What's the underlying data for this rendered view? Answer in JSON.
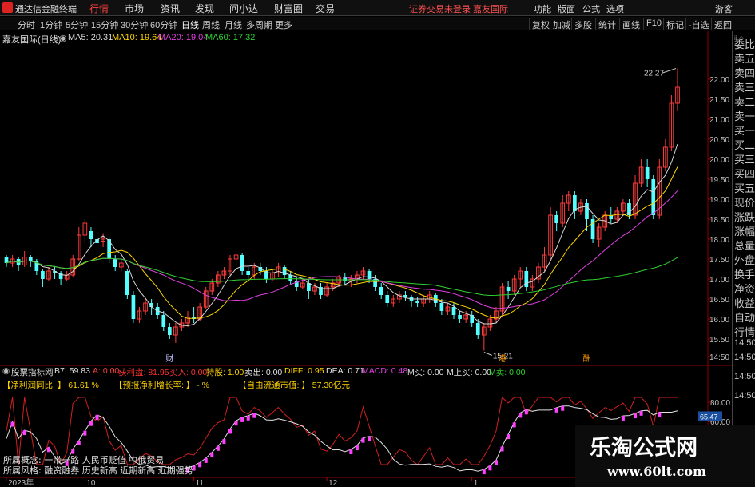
{
  "menubar": {
    "app_title": "通达信金融终端",
    "menus": [
      "行情",
      "市场",
      "资讯",
      "发现",
      "问小达",
      "财富圈",
      "交易"
    ],
    "active_menu": "行情",
    "broker_status": "证券交易未登录  嘉友国际",
    "right_menus": [
      "功能",
      "版面",
      "公式",
      "选项",
      "游客"
    ]
  },
  "periods": {
    "items": [
      "分时",
      "1分钟",
      "5分钟",
      "15分钟",
      "30分钟",
      "60分钟",
      "日线",
      "周线",
      "月线",
      "多周期",
      "更多"
    ],
    "active": "日线"
  },
  "toolbar": {
    "items": [
      "复权",
      "加减",
      "多股",
      "统计",
      "画线",
      "F10",
      "标记",
      "-自选",
      "返回"
    ]
  },
  "main_chart": {
    "stock_name": "嘉友国际(日线)",
    "ma": [
      {
        "label": "MA5: 20.31",
        "color": "#d8d8d8"
      },
      {
        "label": "MA10: 19.64",
        "color": "#ffd700"
      },
      {
        "label": "MA20: 19.04",
        "color": "#e040e0"
      },
      {
        "label": "MA60: 17.32",
        "color": "#30d030"
      }
    ],
    "high_label": "22.27",
    "low_label": "15.21",
    "markers": [
      "财",
      "港",
      "酬"
    ]
  },
  "chart_data": {
    "type": "candlestick",
    "period": "daily",
    "y_axis_ticks": [
      "22.00",
      "21.50",
      "21.00",
      "20.50",
      "20.00",
      "19.50",
      "19.00",
      "18.50",
      "18.00",
      "17.50",
      "17.00",
      "16.50",
      "16.00",
      "15.50",
      "14:50"
    ],
    "y_range": [
      15.3,
      22.5
    ],
    "x_labels": [
      "2023年",
      "10",
      "11",
      "12",
      "1"
    ],
    "candles": [
      [
        17.55,
        17.4,
        17.6,
        17.3
      ],
      [
        17.4,
        17.5,
        17.6,
        17.3
      ],
      [
        17.5,
        17.35,
        17.55,
        17.2
      ],
      [
        17.35,
        17.55,
        17.7,
        17.3
      ],
      [
        17.55,
        17.45,
        17.6,
        17.3
      ],
      [
        17.45,
        17.2,
        17.5,
        17.1
      ],
      [
        17.2,
        17.0,
        17.25,
        16.8
      ],
      [
        17.0,
        17.2,
        17.3,
        16.95
      ],
      [
        17.2,
        17.15,
        17.3,
        17.0
      ],
      [
        17.15,
        17.0,
        17.2,
        16.85
      ],
      [
        17.0,
        17.1,
        17.2,
        16.95
      ],
      [
        17.1,
        17.5,
        17.6,
        17.05
      ],
      [
        17.5,
        18.1,
        18.3,
        17.45
      ],
      [
        18.1,
        18.4,
        18.5,
        17.9
      ],
      [
        18.2,
        18.0,
        18.3,
        17.8
      ],
      [
        18.0,
        17.9,
        18.1,
        17.75
      ],
      [
        17.95,
        18.0,
        18.15,
        17.8
      ],
      [
        18.0,
        17.5,
        18.05,
        17.4
      ],
      [
        17.5,
        17.3,
        17.6,
        17.2
      ],
      [
        17.3,
        17.4,
        17.5,
        17.2
      ],
      [
        17.2,
        16.6,
        17.25,
        16.5
      ],
      [
        16.6,
        16.0,
        16.7,
        15.9
      ],
      [
        16.0,
        16.2,
        16.3,
        15.9
      ],
      [
        16.2,
        16.4,
        16.5,
        16.1
      ],
      [
        16.4,
        16.3,
        16.5,
        16.1
      ],
      [
        16.3,
        16.1,
        16.4,
        16.0
      ],
      [
        16.1,
        15.8,
        16.2,
        15.7
      ],
      [
        15.8,
        15.6,
        15.9,
        15.5
      ],
      [
        15.6,
        15.8,
        15.9,
        15.4
      ],
      [
        15.8,
        15.9,
        16.0,
        15.7
      ],
      [
        15.9,
        16.05,
        16.2,
        15.8
      ],
      [
        16.05,
        16.0,
        16.3,
        15.9
      ],
      [
        16.0,
        16.3,
        16.4,
        15.95
      ],
      [
        16.3,
        16.7,
        16.8,
        16.25
      ],
      [
        16.7,
        16.9,
        17.0,
        16.6
      ],
      [
        16.9,
        17.1,
        17.2,
        16.8
      ],
      [
        17.1,
        17.2,
        17.3,
        17.0
      ],
      [
        17.2,
        17.5,
        17.6,
        17.1
      ],
      [
        17.5,
        17.6,
        17.7,
        17.35
      ],
      [
        17.6,
        17.2,
        17.65,
        17.1
      ],
      [
        17.2,
        17.1,
        17.3,
        17.0
      ],
      [
        17.1,
        17.3,
        17.4,
        17.0
      ],
      [
        17.3,
        17.2,
        17.4,
        17.1
      ],
      [
        17.2,
        17.0,
        17.3,
        16.9
      ],
      [
        17.0,
        17.15,
        17.25,
        16.95
      ],
      [
        17.15,
        17.3,
        17.4,
        17.05
      ],
      [
        17.3,
        17.1,
        17.35,
        17.0
      ],
      [
        17.1,
        16.95,
        17.2,
        16.85
      ],
      [
        16.95,
        16.8,
        17.05,
        16.7
      ],
      [
        16.8,
        16.9,
        17.0,
        16.75
      ],
      [
        16.9,
        16.7,
        17.0,
        16.5
      ],
      [
        16.7,
        16.8,
        16.9,
        16.6
      ],
      [
        16.8,
        16.6,
        16.9,
        16.5
      ],
      [
        16.6,
        16.8,
        16.9,
        16.55
      ],
      [
        16.8,
        16.9,
        17.0,
        16.7
      ],
      [
        16.9,
        17.05,
        17.1,
        16.8
      ],
      [
        17.05,
        16.95,
        17.15,
        16.85
      ],
      [
        16.95,
        17.0,
        17.1,
        16.8
      ],
      [
        17.0,
        17.1,
        17.2,
        16.9
      ],
      [
        17.1,
        17.2,
        17.3,
        17.0
      ],
      [
        17.2,
        17.0,
        17.25,
        16.9
      ],
      [
        17.0,
        16.8,
        17.1,
        16.7
      ],
      [
        16.8,
        16.6,
        16.9,
        16.5
      ],
      [
        16.6,
        16.4,
        16.7,
        16.3
      ],
      [
        16.4,
        16.5,
        16.6,
        16.3
      ],
      [
        16.5,
        16.6,
        16.7,
        16.4
      ],
      [
        16.6,
        16.55,
        16.7,
        16.45
      ],
      [
        16.55,
        16.45,
        16.6,
        16.3
      ],
      [
        16.45,
        16.4,
        16.55,
        16.3
      ],
      [
        16.4,
        16.5,
        16.6,
        16.3
      ],
      [
        16.5,
        16.6,
        16.7,
        16.4
      ],
      [
        16.6,
        16.4,
        16.65,
        16.3
      ],
      [
        16.4,
        16.2,
        16.5,
        16.1
      ],
      [
        16.2,
        16.3,
        16.4,
        16.1
      ],
      [
        16.3,
        16.1,
        16.4,
        16.0
      ],
      [
        16.1,
        16.0,
        16.2,
        15.9
      ],
      [
        16.0,
        16.1,
        16.2,
        15.9
      ],
      [
        16.1,
        15.9,
        16.2,
        15.8
      ],
      [
        15.9,
        15.6,
        16.0,
        15.5
      ],
      [
        15.6,
        15.8,
        15.9,
        15.21
      ],
      [
        15.8,
        16.0,
        16.1,
        15.7
      ],
      [
        16.0,
        16.2,
        16.3,
        15.9
      ],
      [
        16.2,
        16.8,
        16.9,
        16.1
      ],
      [
        16.8,
        16.7,
        16.95,
        16.5
      ],
      [
        16.7,
        17.0,
        17.1,
        16.6
      ],
      [
        17.0,
        17.2,
        17.3,
        16.8
      ],
      [
        17.2,
        16.8,
        17.3,
        16.7
      ],
      [
        16.8,
        17.0,
        17.1,
        16.7
      ],
      [
        17.0,
        17.3,
        17.4,
        16.9
      ],
      [
        17.3,
        17.6,
        17.8,
        17.2
      ],
      [
        17.6,
        18.6,
        18.8,
        17.5
      ],
      [
        18.6,
        18.4,
        18.7,
        18.2
      ],
      [
        18.4,
        18.9,
        19.1,
        18.3
      ],
      [
        18.9,
        19.1,
        19.2,
        18.7
      ],
      [
        19.1,
        18.7,
        19.2,
        18.5
      ],
      [
        18.7,
        18.9,
        19.0,
        18.6
      ],
      [
        18.9,
        18.5,
        19.0,
        18.2
      ],
      [
        18.5,
        18.0,
        18.6,
        17.9
      ],
      [
        18.0,
        18.3,
        18.4,
        17.8
      ],
      [
        18.3,
        18.6,
        18.7,
        18.2
      ],
      [
        18.6,
        18.5,
        18.8,
        18.4
      ],
      [
        18.5,
        18.7,
        18.8,
        18.4
      ],
      [
        18.7,
        18.9,
        19.0,
        18.6
      ],
      [
        18.9,
        18.6,
        19.0,
        18.5
      ],
      [
        18.6,
        19.4,
        19.6,
        18.5
      ],
      [
        19.4,
        19.8,
        20.0,
        19.3
      ],
      [
        19.8,
        19.5,
        20.0,
        19.3
      ],
      [
        19.5,
        18.6,
        19.6,
        18.5
      ],
      [
        18.6,
        19.8,
        20.0,
        18.5
      ],
      [
        19.8,
        20.3,
        20.5,
        19.7
      ],
      [
        20.3,
        21.4,
        21.6,
        20.2
      ],
      [
        21.4,
        21.8,
        22.27,
        21.2
      ]
    ],
    "ma_values": {
      "MA5": 20.31,
      "MA10": 19.64,
      "MA20": 19.04,
      "MA60": 17.32
    }
  },
  "sub_chart": {
    "indicator": "股票指标网",
    "values": [
      {
        "label": "B7: 59.83",
        "color": "#e0e0e0"
      },
      {
        "label": "A: 0.00",
        "color": "#ff4040"
      },
      {
        "label": "获利盘: 81.95",
        "color": "#ff3030"
      },
      {
        "label": "买入: 0.00",
        "color": "#ff3030"
      },
      {
        "label": "持股: 1.00",
        "color": "#ffd200"
      },
      {
        "label": "卖出: 0.00",
        "color": "#e0e0e0"
      },
      {
        "label": "DIFF: 0.95",
        "color": "#ffd200"
      },
      {
        "label": "DEA: 0.71",
        "color": "#e0e0e0"
      },
      {
        "label": "MACD: 0.48",
        "color": "#e040e0"
      },
      {
        "label": "M买: 0.00",
        "color": "#e0e0e0"
      },
      {
        "label": "M上买: 0.00",
        "color": "#e0e0e0"
      },
      {
        "label": "M卖: 0.00",
        "color": "#30d030"
      }
    ],
    "row2": [
      "【净利润同比: 】 61.61 %",
      "【预报净利增长率: 】 - %",
      "【自由流通市值: 】 57.30亿元"
    ],
    "bottom_text_1": "所属概念: 一带一路 人民币贬值 中俄贸易",
    "bottom_text_2": "所属风格: 融资融券 历史新高 近期新高 近期强势",
    "y_ticks": [
      "80.00",
      "65.47",
      "60.00"
    ],
    "current_badge": "65.47"
  },
  "right_panel": {
    "items": [
      "委比",
      "卖五",
      "卖四",
      "卖三",
      "卖二",
      "卖一",
      "买一",
      "买二",
      "买三",
      "买四",
      "买五",
      "现价",
      "涨跌",
      "涨幅",
      "总量",
      "外盘",
      "换手",
      "净资",
      "收益",
      "自动",
      "行情",
      "14:50",
      "14:50",
      "14:50",
      "14:50"
    ]
  },
  "watermark": {
    "title": "乐淘公式网",
    "url": "www.60lt.com"
  }
}
